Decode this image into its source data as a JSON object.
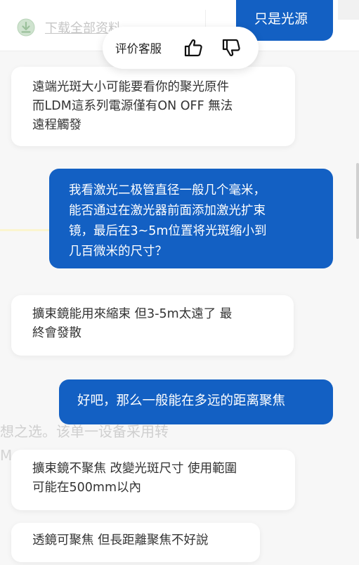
{
  "background": {
    "download_label": "下载全部资料",
    "faded_text_line1": "想之选。该单一设备采用转",
    "faded_text_line2": "M"
  },
  "rating": {
    "label": "评价客服",
    "thumbs_up_icon": "thumbs-up-icon",
    "thumbs_down_icon": "thumbs-down-icon"
  },
  "colors": {
    "user_bubble": "#1360c3",
    "agent_bubble": "#ffffff",
    "page_bg": "#f7f7f7"
  },
  "messages": [
    {
      "role": "user",
      "lines": [
        "只是光源"
      ]
    },
    {
      "role": "agent",
      "lines": [
        "遠端光斑大小可能要看你的聚光原件",
        "而LDM這系列電源僅有ON OFF 無法",
        "遠程觸發"
      ]
    },
    {
      "role": "user",
      "lines": [
        "我看激光二极管直径一般几个毫米，",
        "能否通过在激光器前面添加激光扩束",
        "镜，最后在3~5m位置将光斑缩小到",
        "几百微米的尺寸？"
      ]
    },
    {
      "role": "agent",
      "lines": [
        "擴束鏡能用來縮束 但3-5m太遠了 最",
        "終會發散"
      ]
    },
    {
      "role": "user",
      "lines": [
        "好吧，那么一般能在多远的距离聚焦"
      ]
    },
    {
      "role": "agent",
      "lines": [
        "擴束鏡不聚焦 改變光斑尺寸 使用範圍",
        "可能在500mm以內"
      ]
    },
    {
      "role": "agent",
      "lines": [
        "透鏡可聚焦 但長距離聚焦不好說"
      ]
    }
  ]
}
